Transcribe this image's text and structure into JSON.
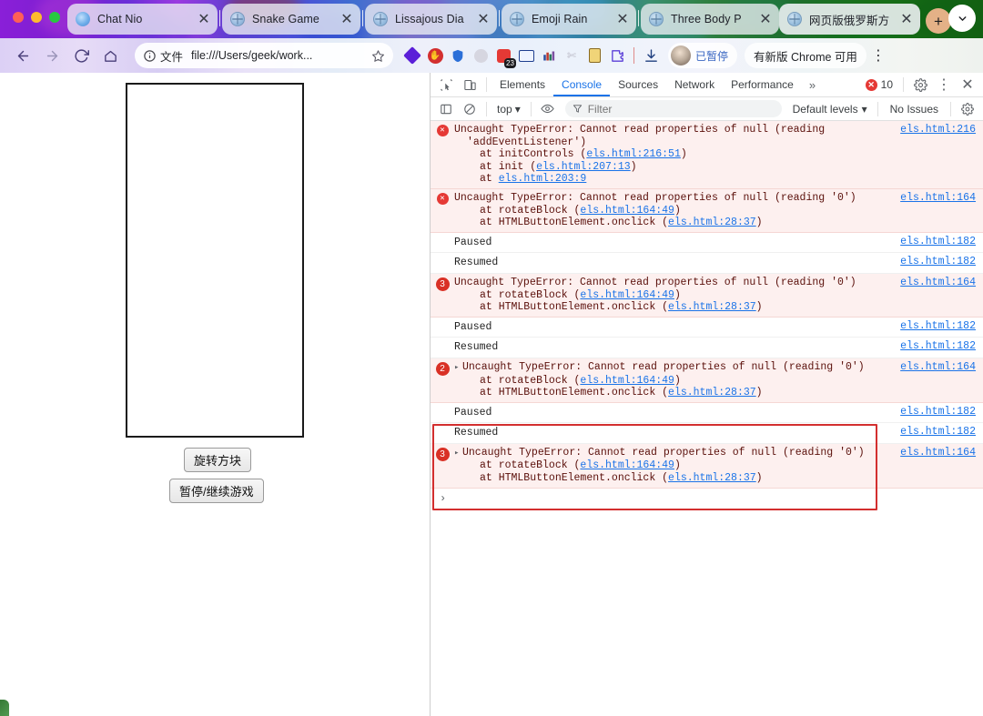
{
  "window": {
    "traffic_lights": [
      "close",
      "minimize",
      "maximize"
    ]
  },
  "tabs": [
    {
      "title": "Chat Nio",
      "favicon": "chatnio-icon",
      "active": false,
      "close_label": "✕"
    },
    {
      "title": "Snake Game",
      "favicon": "globe-icon",
      "active": false,
      "close_label": "✕"
    },
    {
      "title": "Lissajous Dia",
      "favicon": "globe-icon",
      "active": false,
      "close_label": "✕"
    },
    {
      "title": "Emoji Rain",
      "favicon": "globe-icon",
      "active": false,
      "close_label": "✕"
    },
    {
      "title": "Three Body P",
      "favicon": "globe-icon",
      "active": false,
      "close_label": "✕"
    },
    {
      "title": "网页版俄罗斯方",
      "favicon": "globe-icon",
      "active": true,
      "close_label": "✕"
    }
  ],
  "tabstrip": {
    "new_tab_label": "+",
    "tab_search_label": "⌄"
  },
  "toolbar": {
    "back_label": "←",
    "forward_label": "→",
    "reload_label": "⟳",
    "home_label": "home-icon",
    "omnibox": {
      "info_label": "ⓘ",
      "site_chip": "文件",
      "url": "file:///Users/geek/work...",
      "star_label": "☆"
    },
    "extensions": [
      {
        "name": "diamond-extension-icon",
        "badge": ""
      },
      {
        "name": "stop-hand-extension-icon",
        "badge": ""
      },
      {
        "name": "shield-extension-icon",
        "badge": ""
      },
      {
        "name": "circle-extension-icon",
        "badge": ""
      },
      {
        "name": "red-badge-extension-icon",
        "badge": "23"
      },
      {
        "name": "card-extension-icon",
        "badge": ""
      },
      {
        "name": "city-extension-icon",
        "badge": ""
      },
      {
        "name": "scissors-extension-icon",
        "badge": ""
      },
      {
        "name": "note-extension-icon",
        "badge": ""
      },
      {
        "name": "puzzle-extension-icon",
        "badge": ""
      }
    ],
    "download_label": "download-icon",
    "profile": {
      "text": "已暂停",
      "avatar": "user-avatar"
    },
    "update_chip": "有新版 Chrome 可用",
    "menu_label": "⋮"
  },
  "page": {
    "canvas_name": "tetris-game-canvas",
    "buttons": [
      {
        "label": "旋转方块",
        "name": "rotate-block-button"
      },
      {
        "label": "暂停/继续游戏",
        "name": "pause-resume-button"
      }
    ]
  },
  "devtools": {
    "inspect_icon": "inspect-element-icon",
    "device_icon": "device-toolbar-icon",
    "tabs": [
      {
        "label": "Elements",
        "active": false
      },
      {
        "label": "Console",
        "active": true
      },
      {
        "label": "Sources",
        "active": false
      },
      {
        "label": "Network",
        "active": false
      },
      {
        "label": "Performance",
        "active": false
      }
    ],
    "more_tabs_label": "»",
    "error_count": "10",
    "settings_label": "gear-icon",
    "kebab_label": "⋮",
    "close_label": "✕",
    "console_toolbar": {
      "sidebar_label": "console-sidebar-icon",
      "clear_label": "clear-console-icon",
      "context": "top",
      "context_caret": "▾",
      "eye_label": "live-expressions-icon",
      "filter_icon": "filter-icon",
      "filter_placeholder": "Filter",
      "filter_value": "",
      "levels": "Default levels",
      "levels_caret": "▾",
      "issues": "No Issues",
      "settings_label": "console-settings-icon"
    },
    "messages": [
      {
        "type": "error",
        "badge": "",
        "expandable": false,
        "lines": [
          "Uncaught TypeError: Cannot read properties of null (reading",
          "'addEventListener')"
        ],
        "stack": [
          {
            "prefix": "at initControls (",
            "link": "els.html:216:51",
            "suffix": ")"
          },
          {
            "prefix": "at init (",
            "link": "els.html:207:13",
            "suffix": ")"
          },
          {
            "prefix": "at ",
            "link": "els.html:203:9",
            "suffix": ""
          }
        ],
        "source": "els.html:216"
      },
      {
        "type": "error",
        "badge": "",
        "expandable": false,
        "lines": [
          "Uncaught TypeError: Cannot read properties of null (reading '0')"
        ],
        "stack": [
          {
            "prefix": "at rotateBlock (",
            "link": "els.html:164:49",
            "suffix": ")"
          },
          {
            "prefix": "at HTMLButtonElement.onclick (",
            "link": "els.html:28:37",
            "suffix": ")"
          }
        ],
        "source": "els.html:164"
      },
      {
        "type": "log",
        "text": "Paused",
        "source": "els.html:182"
      },
      {
        "type": "log",
        "text": "Resumed",
        "source": "els.html:182"
      },
      {
        "type": "error",
        "badge": "3",
        "expandable": false,
        "lines": [
          "Uncaught TypeError: Cannot read properties of null (reading '0')"
        ],
        "stack": [
          {
            "prefix": "at rotateBlock (",
            "link": "els.html:164:49",
            "suffix": ")"
          },
          {
            "prefix": "at HTMLButtonElement.onclick (",
            "link": "els.html:28:37",
            "suffix": ")"
          }
        ],
        "source": "els.html:164"
      },
      {
        "type": "log",
        "text": "Paused",
        "source": "els.html:182"
      },
      {
        "type": "log",
        "text": "Resumed",
        "source": "els.html:182"
      },
      {
        "type": "error",
        "badge": "2",
        "expandable": true,
        "lines": [
          "Uncaught TypeError: Cannot read properties of null (reading '0')"
        ],
        "stack": [
          {
            "prefix": "at rotateBlock (",
            "link": "els.html:164:49",
            "suffix": ")"
          },
          {
            "prefix": "at HTMLButtonElement.onclick (",
            "link": "els.html:28:37",
            "suffix": ")"
          }
        ],
        "source": "els.html:164"
      },
      {
        "type": "log",
        "text": "Paused",
        "source": "els.html:182"
      },
      {
        "type": "log",
        "text": "Resumed",
        "source": "els.html:182"
      },
      {
        "type": "error",
        "badge": "3",
        "expandable": true,
        "lines": [
          "Uncaught TypeError: Cannot read properties of null (reading '0')"
        ],
        "stack": [
          {
            "prefix": "at rotateBlock (",
            "link": "els.html:164:49",
            "suffix": ")"
          },
          {
            "prefix": "at HTMLButtonElement.onclick (",
            "link": "els.html:28:37",
            "suffix": ")"
          }
        ],
        "source": "els.html:164"
      }
    ],
    "prompt_caret": "›",
    "expand_triangle": "▸",
    "highlight_color": "#d32f2f"
  }
}
